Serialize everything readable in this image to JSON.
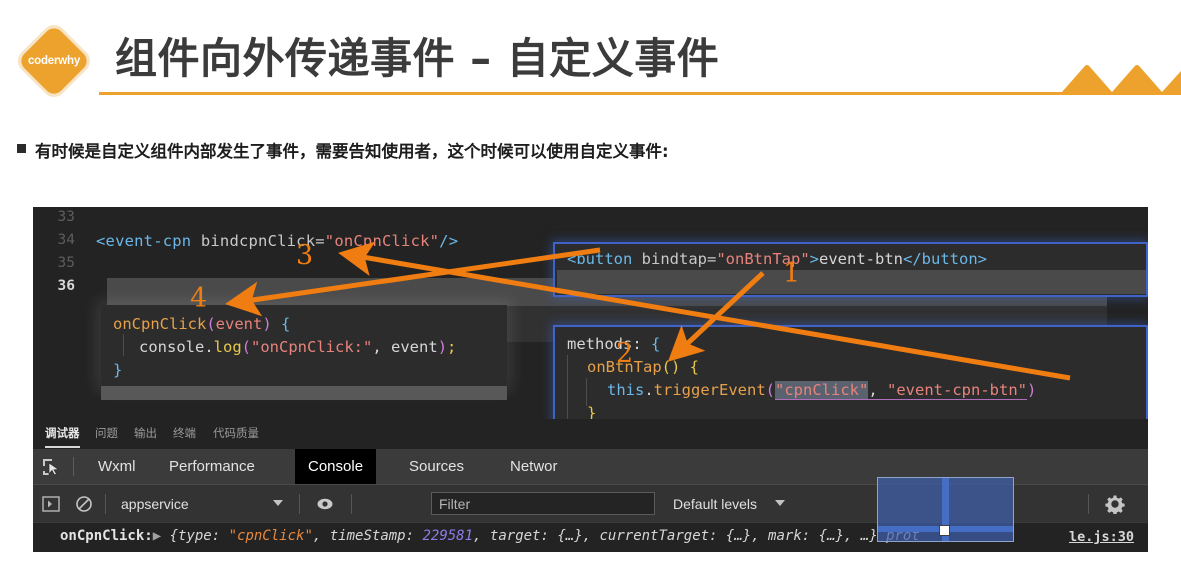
{
  "header": {
    "logo_text": "coderwhy",
    "title": "组件向外传递事件 – 自定义事件",
    "accent_color": "#eda22d",
    "title_color": "#3b3b3b"
  },
  "bullet": {
    "marker": "square-bullet",
    "text": "有时候是自定义组件内部发生了事件，需要告知使用者，这个时候可以使用自定义事件:"
  },
  "editor": {
    "line_numbers": [
      "33",
      "34",
      "35",
      "36"
    ],
    "current_line": "36",
    "main_line": {
      "tag_open": "<event-cpn",
      "attr": " bindcpnClick=",
      "value": "\"onCpnClick\"",
      "tag_close": "/>"
    },
    "left_box": {
      "l1_fn": "onCpnClick",
      "l1_paren_open": "(",
      "l1_param": "event",
      "l1_paren_close": ")",
      "l1_brace": " {",
      "l2_obj": "console",
      "l2_dot": ".",
      "l2_method": "log",
      "l2_paren_open": "(",
      "l2_str": "\"onCpnClick:\"",
      "l2_comma": ", ",
      "l2_arg": "event",
      "l2_paren_close": ")",
      "l2_semi": ";",
      "l3_brace": "}"
    },
    "wxml_box": {
      "tag_open": "<button",
      "attr": " bindtap=",
      "value": "\"onBtnTap\"",
      "gt": ">",
      "content": "event-btn",
      "tag_close": "</button>"
    },
    "js_box": {
      "l1_key": "methods",
      "l1_colon": ": ",
      "l1_brace": "{",
      "l2_fn": "onBtnTap",
      "l2_parens": "()",
      "l2_brace": " {",
      "l3_this": "this",
      "l3_dot": ".",
      "l3_method": "triggerEvent",
      "l3_paren_open": "(",
      "l3_arg1": "\"cpnClick\"",
      "l3_comma": ", ",
      "l3_arg2": "\"event-cpn-btn\"",
      "l3_paren_close": ")",
      "l4_brace": "}",
      "l5_brace": "}"
    }
  },
  "panel_tabs": [
    {
      "label": "调试器",
      "active": true
    },
    {
      "label": "问题",
      "active": false
    },
    {
      "label": "输出",
      "active": false
    },
    {
      "label": "终端",
      "active": false
    },
    {
      "label": "代码质量",
      "active": false
    }
  ],
  "devtools_tabs": [
    {
      "label": "Wxml",
      "active": false
    },
    {
      "label": "Performance",
      "active": false
    },
    {
      "label": "Console",
      "active": true
    },
    {
      "label": "Sources",
      "active": false
    },
    {
      "label": "Networ",
      "active": false
    }
  ],
  "console_toolbar": {
    "sidebar_icon": "sidebar-toggle-icon",
    "clear_icon": "clear-console-icon",
    "context_value": "appservice",
    "eye_icon": "live-expression-icon",
    "filter_placeholder": "Filter",
    "levels_value": "Default levels",
    "gear_icon": "settings-gear-icon"
  },
  "console_log": {
    "label": "onCpnClick:",
    "disclosure": "▶",
    "obj_open": " {type: ",
    "type_value": "\"cpnClick\"",
    "mid1": ", timeStamp: ",
    "timestamp": "229581",
    "mid2": ", target: {…}, currentTarget: {…}, mark",
    "tail": ": {…}, …} prot",
    "source": "le.js:30"
  },
  "annotations": {
    "numbers": [
      "1",
      "2",
      "3",
      "4"
    ],
    "color": "#f07d11"
  },
  "selection_overlay": {
    "name": "selection-rectangle",
    "color": "#3e5faa"
  }
}
